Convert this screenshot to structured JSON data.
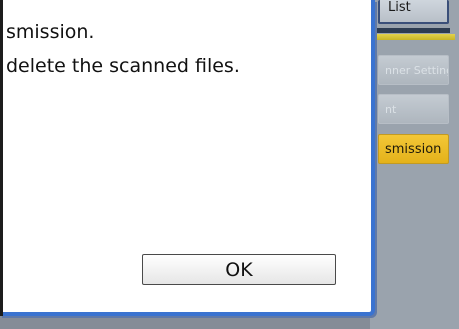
{
  "dialog": {
    "message_line1": "smission.",
    "message_line2": "delete the scanned files.",
    "ok_label": "OK"
  },
  "background": {
    "list_label": "List",
    "scanner_settings_label": "nner Settings",
    "print_label": "nt",
    "transmission_label": "smission"
  }
}
